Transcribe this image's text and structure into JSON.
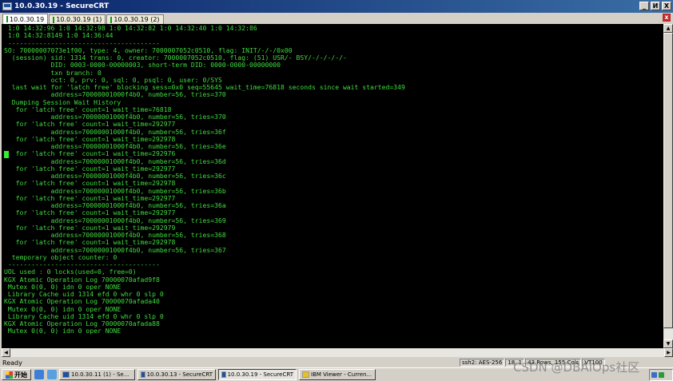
{
  "window": {
    "title": "10.0.30.19 - SecureCRT",
    "buttons": [
      "_",
      "И",
      "X"
    ]
  },
  "tabs": [
    {
      "label": "10.0.30.19",
      "active": true
    },
    {
      "label": "10.0.30.19 (1)",
      "active": false
    },
    {
      "label": "10.0.30.19 (2)",
      "active": false
    }
  ],
  "tab_close": "x",
  "terminal": {
    "lines": [
      " 1:0 14:32:96 1:0 14:32:98 1:0 14:32:82 1:0 14:32:40 1:0 14:32:86",
      " 1:0 14:32:8149 1:0 14:36:44",
      " ---------------------------------------",
      "SO: 70000007073e1f00, type: 4, owner: 7000007052c0510, flag: INIT/-/-/0x00",
      "  (session) sid: 1314 trans: 0, creator: 7000007052c0510, flag: (51) USR/- BSY/-/-/-/-/-",
      "            DID: 0003-0000-00000003, short-term DID: 0000-0000-00000000",
      "            txn branch: 0",
      "            oct: 0, prv: 0, sql: 0, psql: 0, user: 0/SYS",
      "  last wait for 'latch free' blocking sess=0x0 seq=55645 wait_time=76818 seconds since wait started=349",
      "            address=70000001000f4b0, number=56, tries=370",
      "  Dumping Session Wait History",
      "   for 'latch free' count=1 wait_time=76818",
      "            address=70000001000f4b0, number=56, tries=370",
      "   for 'latch free' count=1 wait_time=292977",
      "            address=70000001000f4b0, number=56, tries=36f",
      "   for 'latch free' count=1 wait_time=292978",
      "            address=70000001000f4b0, number=56, tries=36e",
      "   for 'latch free' count=1 wait_time=292976",
      "            address=70000001000f4b0, number=56, tries=36d",
      "   for 'latch free' count=1 wait_time=292977",
      "            address=70000001000f4b0, number=56, tries=36c",
      "   for 'latch free' count=1 wait_time=292978",
      "            address=70000001000f4b0, number=56, tries=36b",
      "   for 'latch free' count=1 wait_time=292977",
      "            address=70000001000f4b0, number=56, tries=36a",
      "   for 'latch free' count=1 wait_time=292977",
      "            address=70000001000f4b0, number=56, tries=369",
      "   for 'latch free' count=1 wait_time=292979",
      "            address=70000001000f4b0, number=56, tries=368",
      "   for 'latch free' count=1 wait_time=292978",
      "            address=70000001000f4b0, number=56, tries=367",
      "  temporary object counter: 0",
      " ---------------------------------------",
      "UOL used : 0 locks(used=0, free=0)",
      "KGX Atomic Operation Log 70000070afad9f8",
      " Mutex 0(0, 0) idn 0 oper NONE",
      " Library Cache uid 1314 efd 0 whr 0 slp 0",
      "KGX Atomic Operation Log 70000070afada40",
      " Mutex 0(0, 0) idn 0 oper NONE",
      " Library Cache uid 1314 efd 0 whr 0 slp 0",
      "KGX Atomic Operation Log 70000070afada88",
      " Mutex 0(0, 0) idn 0 oper NONE"
    ]
  },
  "statusbar": {
    "ready": "Ready",
    "cells": [
      "ssh2: AES-256",
      "18, 1",
      "43 Rows, 155 Cols",
      "VT100"
    ]
  },
  "taskbar": {
    "start": "开始",
    "tasks": [
      {
        "label": "10.0.30.11 (1) - Se...",
        "active": false
      },
      {
        "label": "10.0.30.13 - SecureCRT",
        "active": false
      },
      {
        "label": "10.0.30.19 - SecureCRT",
        "active": true
      },
      {
        "label": "IBM Viewer - Curren...",
        "active": false
      }
    ]
  },
  "watermark": "CSDN @DBAIOps社区"
}
